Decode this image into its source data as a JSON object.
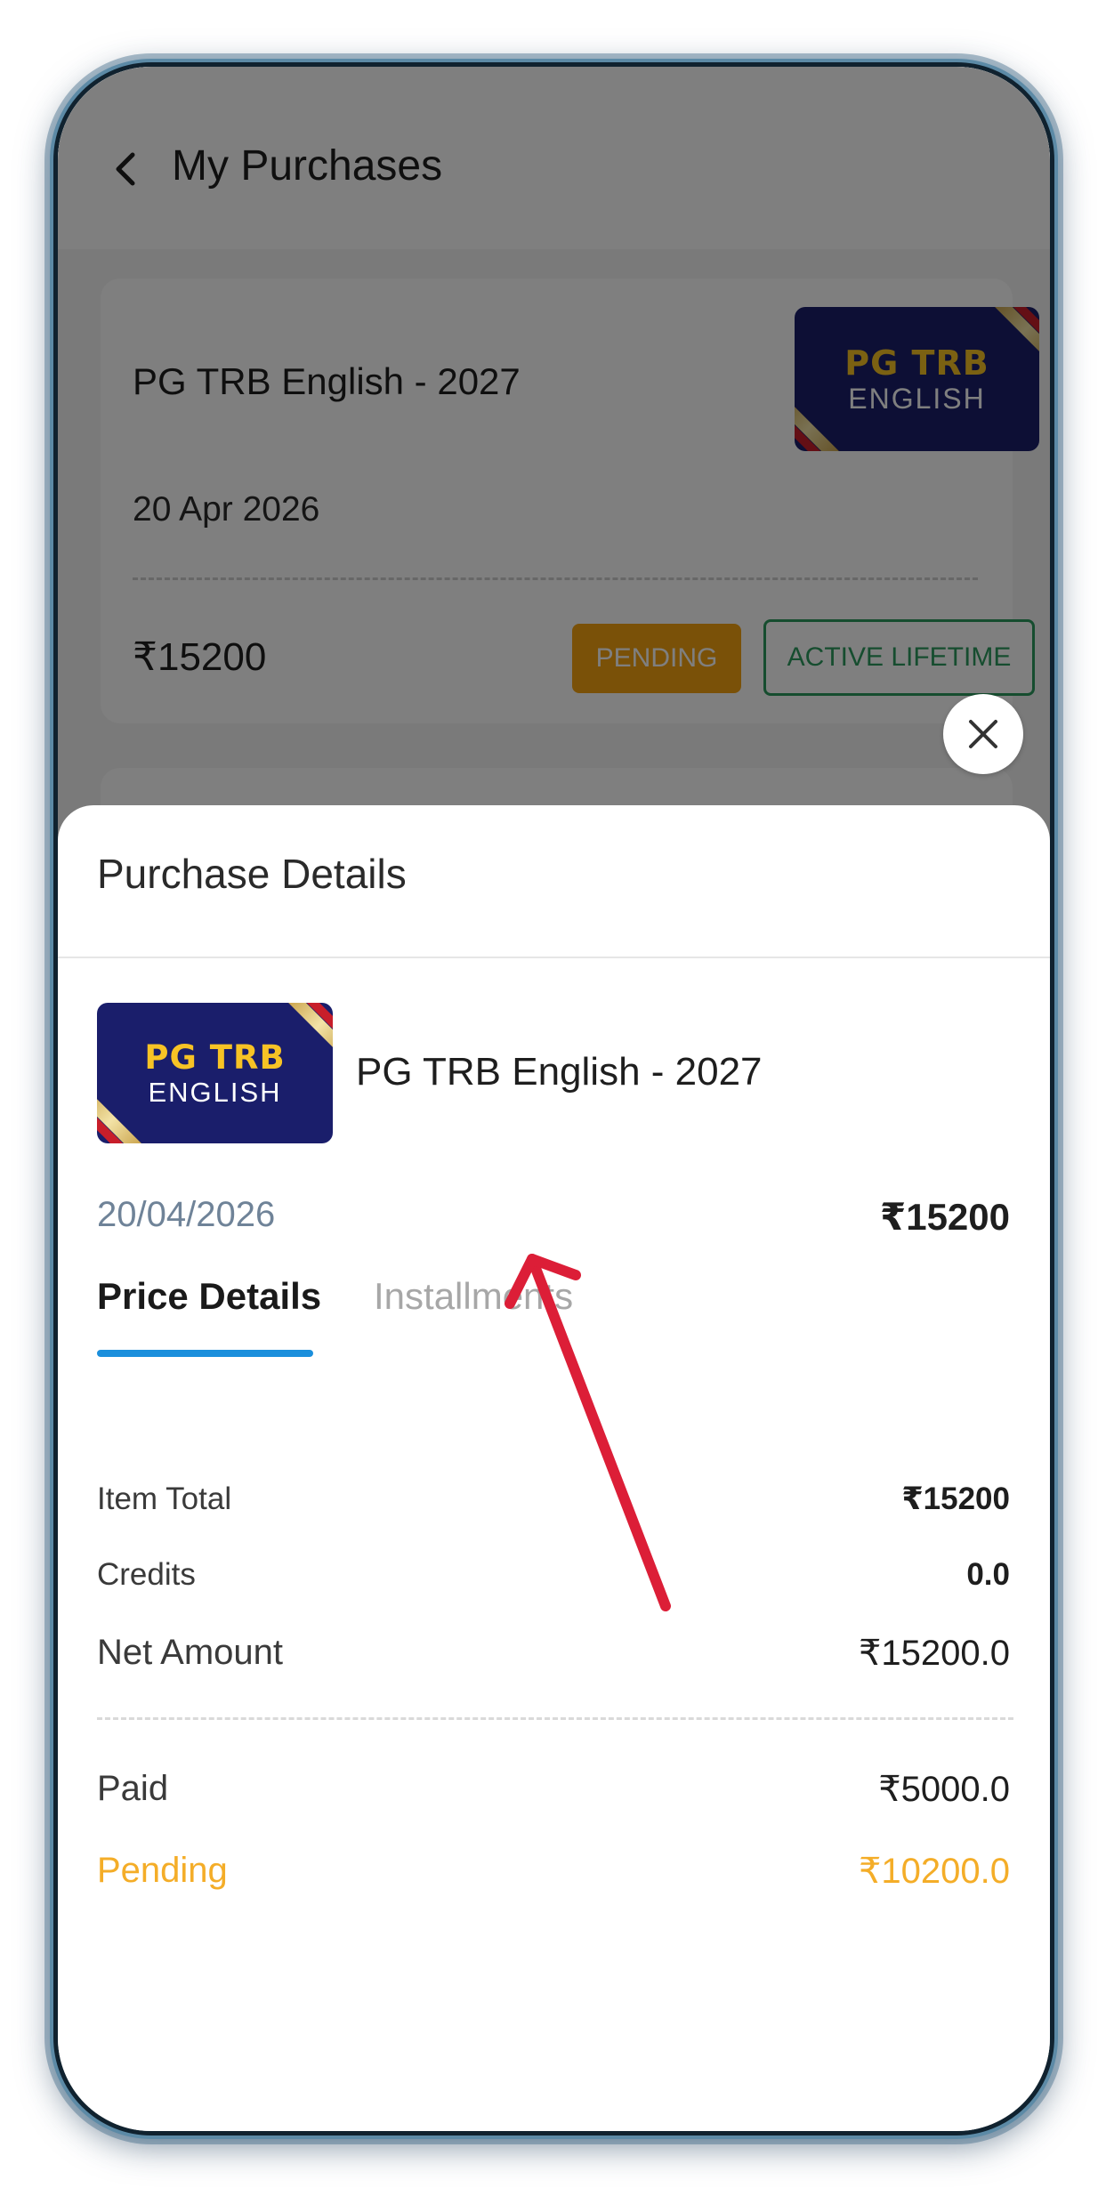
{
  "header": {
    "title": "My Purchases"
  },
  "purchase_card": {
    "title": "PG TRB English - 2027",
    "date": "20 Apr 2026",
    "price": "₹15200",
    "status_badge": "PENDING",
    "validity_badge": "ACTIVE LIFETIME",
    "thumbnail": {
      "line1": "PG TRB",
      "line2": "ENGLISH"
    }
  },
  "sheet": {
    "title": "Purchase Details",
    "product_name": "PG TRB English - 2027",
    "thumbnail": {
      "line1": "PG TRB",
      "line2": "ENGLISH"
    },
    "date": "20/04/2026",
    "total": "₹15200",
    "tabs": [
      {
        "label": "Price Details",
        "active": true
      },
      {
        "label": "Installments",
        "active": false
      }
    ],
    "price_rows": [
      {
        "label": "Item Total",
        "value": "₹15200"
      },
      {
        "label": "Credits",
        "value": "0.0"
      },
      {
        "label": "Net Amount",
        "value": "₹15200.0"
      },
      {
        "label": "Paid",
        "value": "₹5000.0"
      },
      {
        "label": "Pending",
        "value": "₹10200.0"
      }
    ]
  },
  "colors": {
    "pending_badge": "#f5a310",
    "active_badge": "#2d9b5f",
    "tab_indicator": "#1b8fdc",
    "pending_text": "#f4ad28",
    "annotation_arrow": "#dc1e37"
  },
  "icons": {
    "back": "chevron-left-icon",
    "close": "close-icon"
  }
}
